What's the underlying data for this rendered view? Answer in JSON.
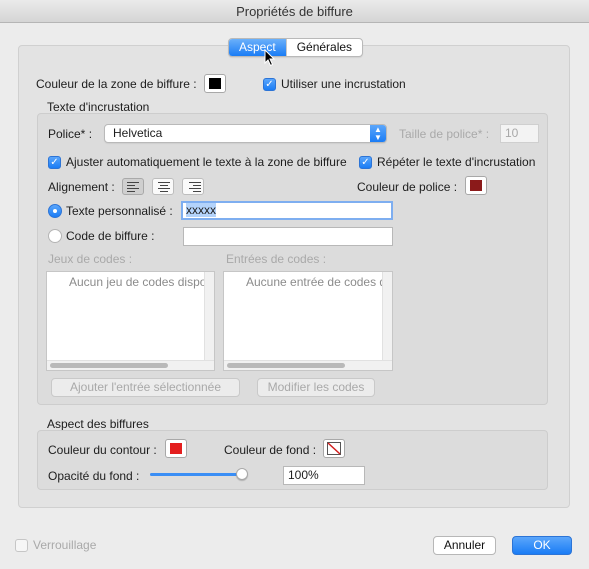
{
  "window": {
    "title": "Propriétés de biffure"
  },
  "tabs": [
    {
      "label": "Aspect",
      "active": true
    },
    {
      "label": "Générales",
      "active": false
    }
  ],
  "zone": {
    "color_label": "Couleur de la zone de biffure :",
    "color": "#000000",
    "use_inlay_label": "Utiliser une incrustation",
    "use_inlay_checked": true
  },
  "inlay": {
    "section_title": "Texte d'incrustation",
    "font_label": "Police* :",
    "font_value": "Helvetica",
    "font_size_label": "Taille de police* :",
    "font_size_value": "10",
    "autofit_label": "Ajuster automatiquement le texte à la zone de biffure",
    "repeat_label": "Répéter le texte d'incrustation",
    "align_label": "Alignement :",
    "font_color_label": "Couleur de police :",
    "font_color": "#8b1a1a",
    "custom_text_label": "Texte personnalisé :",
    "custom_text_value": "xxxxx",
    "code_label": "Code de biffure :",
    "code_value": "",
    "code_sets_label": "Jeux de codes :",
    "code_sets_empty": "Aucun jeu de codes dispo",
    "code_entries_label": "Entrées de codes :",
    "code_entries_empty": "Aucune entrée de codes d",
    "add_selected_btn": "Ajouter l'entrée sélectionnée",
    "edit_codes_btn": "Modifier les codes"
  },
  "appearance": {
    "section_title": "Aspect des biffures",
    "outline_color_label": "Couleur du contour :",
    "outline_color": "#e41e1e",
    "fill_color_label": "Couleur de fond :",
    "fill_opacity_label": "Opacité du fond :",
    "fill_opacity_value": "100%",
    "fill_opacity_fraction": 1.0
  },
  "footer": {
    "lock_label": "Verrouillage",
    "cancel_btn": "Annuler",
    "ok_btn": "OK"
  },
  "colors": {
    "accent": "#1a7cf5"
  }
}
